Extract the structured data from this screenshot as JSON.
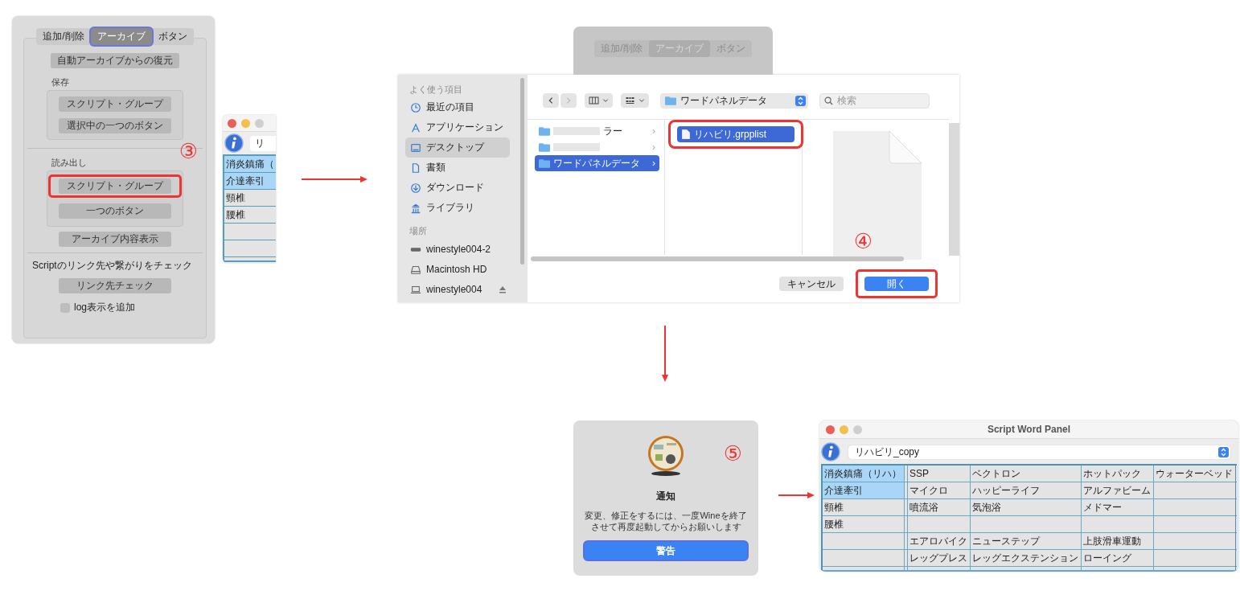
{
  "archive_panel": {
    "tabs": [
      {
        "label": "追加/削除",
        "selected": false
      },
      {
        "label": "アーカイブ",
        "selected": true
      },
      {
        "label": "ボタン",
        "selected": false
      }
    ],
    "restore_button": "自動アーカイブからの復元",
    "save_section": {
      "label": "保存",
      "buttons": [
        "スクリプト・グループ",
        "選択中の一つのボタン"
      ]
    },
    "load_section": {
      "label": "読み出し",
      "buttons": [
        {
          "label": "スクリプト・グループ",
          "highlighted": true
        },
        {
          "label": "一つのボタン",
          "highlighted": false
        }
      ]
    },
    "step_marker": "③",
    "show_archive_button": "アーカイブ内容表示",
    "link_check_label": "Scriptのリンク先や繋がりをチェック",
    "link_check_button": "リンク先チェック",
    "log_checkbox": {
      "label": "log表示を追加",
      "checked": false
    }
  },
  "partial_word_panel": {
    "group_field": "リ",
    "categories": [
      {
        "label": "消炎鎮痛（",
        "selected": true
      },
      {
        "label": "介達牽引",
        "selected": true
      },
      {
        "label": "頸椎",
        "selected": false
      },
      {
        "label": "腰椎",
        "selected": false
      }
    ]
  },
  "background_panel": {
    "tabs": [
      {
        "label": "追加/削除",
        "selected": false
      },
      {
        "label": "アーカイブ",
        "selected": true
      },
      {
        "label": "ボタン",
        "selected": false
      }
    ]
  },
  "file_dialog": {
    "sidebar": [
      {
        "heading": "よく使う項目",
        "items": [
          {
            "label": "最近の項目",
            "selected": false,
            "ejectable": false
          },
          {
            "label": "アプリケーション",
            "selected": false,
            "ejectable": false
          },
          {
            "label": "デスクトップ",
            "selected": true,
            "ejectable": false
          },
          {
            "label": "書類",
            "selected": false,
            "ejectable": false
          },
          {
            "label": "ダウンロード",
            "selected": false,
            "ejectable": false
          },
          {
            "label": "ライブラリ",
            "selected": false,
            "ejectable": false
          }
        ]
      },
      {
        "heading": "場所",
        "items": [
          {
            "label": "winestyle004-2",
            "selected": false,
            "ejectable": false
          },
          {
            "label": "Macintosh HD",
            "selected": false,
            "ejectable": false
          },
          {
            "label": "winestyle004",
            "selected": false,
            "ejectable": true
          }
        ]
      }
    ],
    "path_popup": "ワードパネルデータ",
    "search": {
      "placeholder": "検索"
    },
    "folders": [
      {
        "label": "ラー",
        "chevron": "›",
        "redacted": true,
        "selected": false
      },
      {
        "chevron": "›",
        "redacted": true,
        "selected": false
      },
      {
        "label": "ワードパネルデータ",
        "chevron": "›",
        "redacted": false,
        "selected": true
      }
    ],
    "files": [
      {
        "label": "リハビリ.grpplist",
        "selected": true,
        "highlighted": true
      }
    ],
    "buttons": [
      {
        "label": "キャンセル",
        "kind": "secondary",
        "highlighted": false
      },
      {
        "label": "開く",
        "kind": "primary",
        "highlighted": true
      }
    ],
    "step_marker": "④"
  },
  "notification": {
    "title": "通知",
    "message_lines": [
      "変更、修正をするには、一度Wineを終了",
      "させて再度起動してからお願いします"
    ],
    "button": "警告",
    "step_marker": "⑤"
  },
  "word_panel": {
    "title": "Script Word Panel",
    "group_field": "リハビリ_copy",
    "rows": [
      {
        "category": {
          "label": "消炎鎮痛（リハ）",
          "selected": true
        },
        "words": [
          "SSP",
          "ベクトロン",
          "ホットパック",
          "ウォーターベッド"
        ]
      },
      {
        "category": {
          "label": "介達牽引",
          "selected": true
        },
        "words": [
          "マイクロ",
          "ハッピーライフ",
          "アルファビーム"
        ]
      },
      {
        "category": {
          "label": "頸椎",
          "selected": false
        },
        "words": [
          "噴流浴",
          "気泡浴",
          "メドマー"
        ]
      },
      {
        "category": {
          "label": "腰椎",
          "selected": false
        }
      },
      {
        "words": [
          "エアロバイク",
          "ニューステップ",
          "上肢滑車運動"
        ]
      },
      {
        "words": [
          "レッグプレス",
          "レッグエクステンション",
          "ローイング"
        ]
      }
    ]
  }
}
